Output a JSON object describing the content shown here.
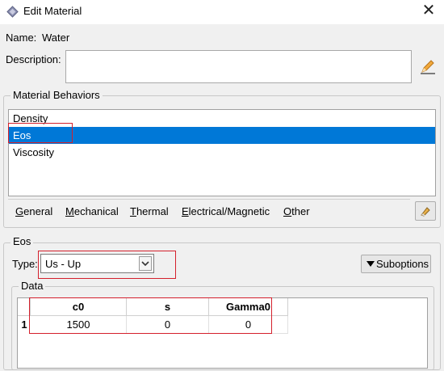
{
  "window": {
    "title": "Edit Material",
    "close_symbol": "✕"
  },
  "name": {
    "label": "Name:",
    "value": "Water"
  },
  "description": {
    "label": "Description:",
    "value": ""
  },
  "behaviors": {
    "group_title": "Material Behaviors",
    "items": [
      {
        "label": "Density",
        "selected": false
      },
      {
        "label": "Eos",
        "selected": true
      },
      {
        "label": "Viscosity",
        "selected": false
      }
    ],
    "menus": [
      {
        "underline": "G",
        "rest": "eneral"
      },
      {
        "underline": "M",
        "rest": "echanical"
      },
      {
        "underline": "T",
        "rest": "hermal"
      },
      {
        "underline": "E",
        "rest": "lectrical/Magnetic"
      },
      {
        "underline": "O",
        "rest": "ther"
      }
    ]
  },
  "eos": {
    "group_title": "Eos",
    "type_label": "Type:",
    "type_value": "Us - Up",
    "suboptions_label": "Suboptions",
    "data_group_title": "Data",
    "columns": [
      "c0",
      "s",
      "Gamma0"
    ],
    "rows": [
      {
        "index": "1",
        "cells": [
          "1500",
          "0",
          "0"
        ]
      }
    ]
  },
  "colors": {
    "selection": "#0078d7",
    "highlight_box": "#d4202c"
  }
}
